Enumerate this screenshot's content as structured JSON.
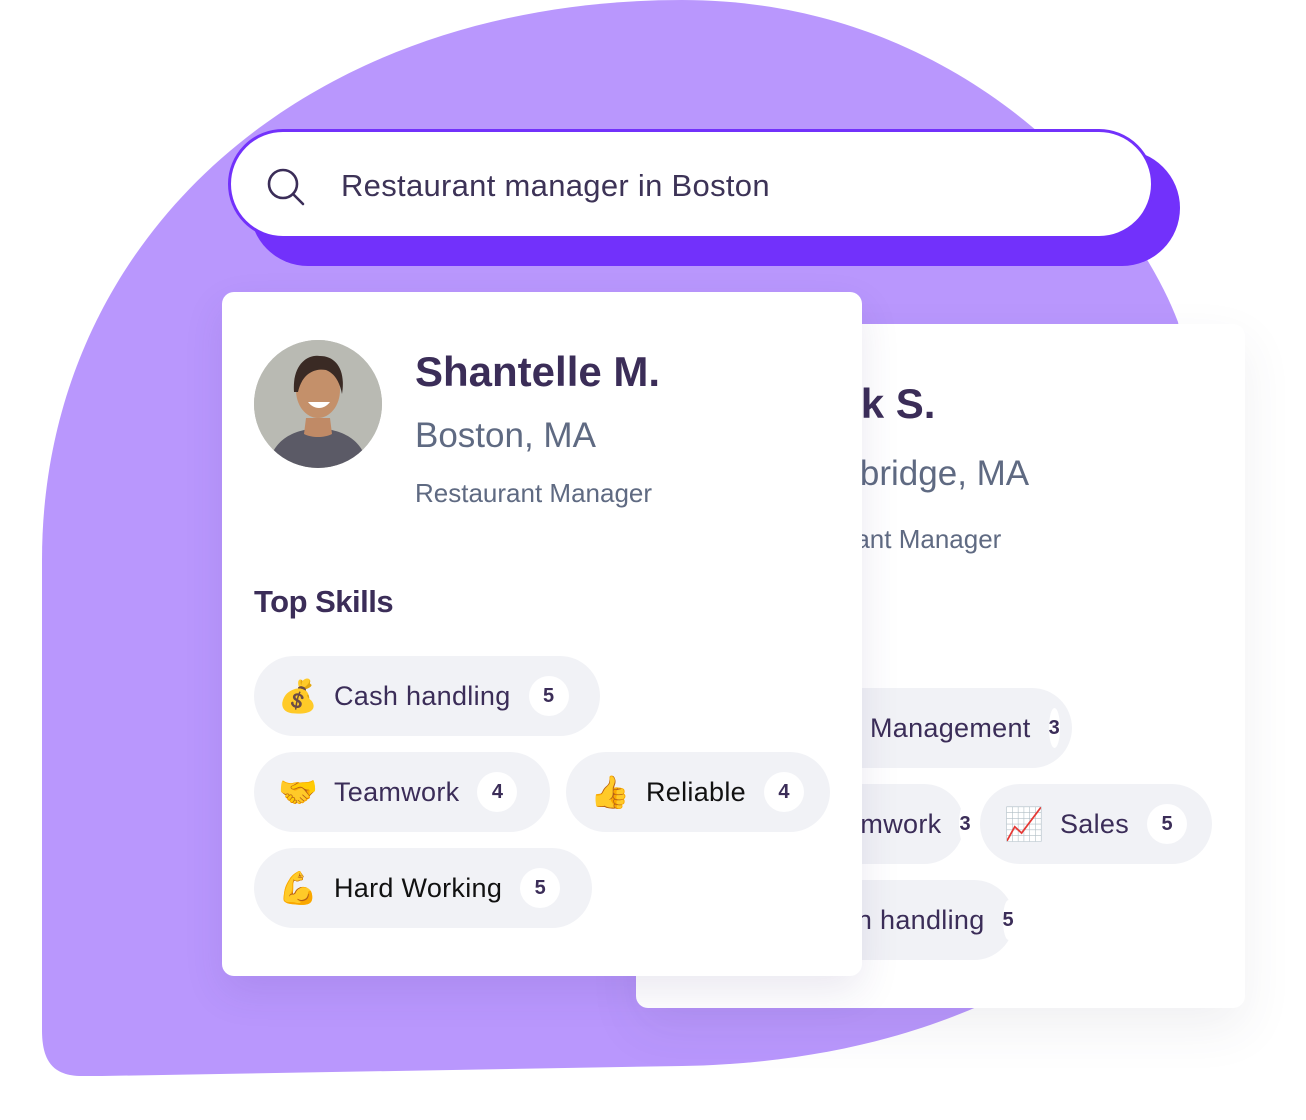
{
  "colors": {
    "background_shape": "#b997fd",
    "accent": "#7231fb",
    "heading": "#3b2d58",
    "muted": "#5f6a82",
    "chip_bg": "#f1f2f6"
  },
  "search": {
    "icon": "search-icon",
    "query": "Restaurant manager in Boston"
  },
  "cards": [
    {
      "name": "Shantelle M.",
      "location": "Boston, MA",
      "role": "Restaurant Manager",
      "skills_title": "Top Skills",
      "skills": [
        {
          "emoji": "💰",
          "icon": "money-bag-icon",
          "label": "Cash handling",
          "count": "5"
        },
        {
          "emoji": "🤝",
          "icon": "handshake-icon",
          "label": "Teamwork",
          "count": "4"
        },
        {
          "emoji": "👍",
          "icon": "thumbs-up-icon",
          "label": "Reliable",
          "count": "4"
        },
        {
          "emoji": "💪",
          "icon": "flexed-biceps-icon",
          "label": "Hard Working",
          "count": "5"
        }
      ]
    },
    {
      "name": "Mark S.",
      "location": "Cambridge, MA",
      "role": "Assistant Manager",
      "skills": [
        {
          "label": "Management",
          "count": "3"
        },
        {
          "label": "Teamwork",
          "count": "3"
        },
        {
          "emoji": "📈",
          "icon": "chart-increasing-icon",
          "label": "Sales",
          "count": "5"
        },
        {
          "label": "Cash handling",
          "count": "5"
        }
      ]
    }
  ]
}
